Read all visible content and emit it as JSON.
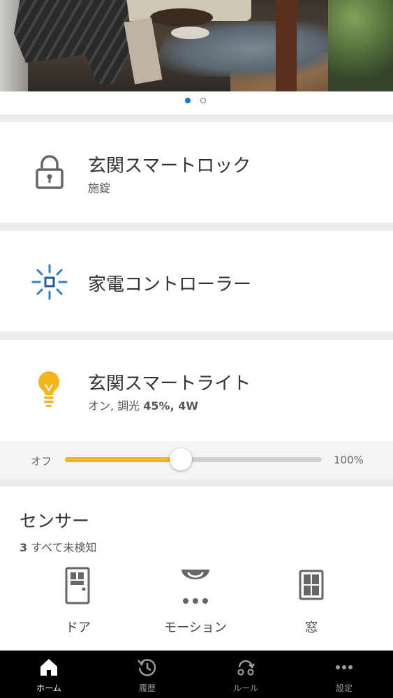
{
  "hero": {
    "active_page": 1,
    "page_count": 2
  },
  "devices": [
    {
      "name": "玄関スマートロック",
      "status": "施錠",
      "icon": "lock-icon"
    },
    {
      "name": "家電コントローラー",
      "icon": "remote-controller-icon"
    },
    {
      "name": "玄関スマートライト",
      "status_prefix": "オン, 調光 ",
      "status_value": "45%, 4W",
      "icon": "lightbulb-icon"
    }
  ],
  "dimmer": {
    "min_label": "オフ",
    "max_label": "100%",
    "level_percent": 45
  },
  "sensors": {
    "title": "センサー",
    "count": "3",
    "summary": " すべて未検知",
    "items": [
      {
        "label": "ドア",
        "icon": "door-icon"
      },
      {
        "label": "モーション",
        "icon": "motion-sensor-icon"
      },
      {
        "label": "窓",
        "icon": "window-icon"
      }
    ]
  },
  "tabs": [
    {
      "label": "ホーム",
      "icon": "home-icon",
      "active": true
    },
    {
      "label": "履歴",
      "icon": "history-icon",
      "active": false
    },
    {
      "label": "ルール",
      "icon": "rules-icon",
      "active": false
    },
    {
      "label": "設定",
      "icon": "more-icon",
      "active": false
    }
  ],
  "colors": {
    "accent_blue": "#1a73c8",
    "light_yellow": "#f3b51c",
    "icon_gray": "#666666",
    "tab_bg": "#000000"
  }
}
